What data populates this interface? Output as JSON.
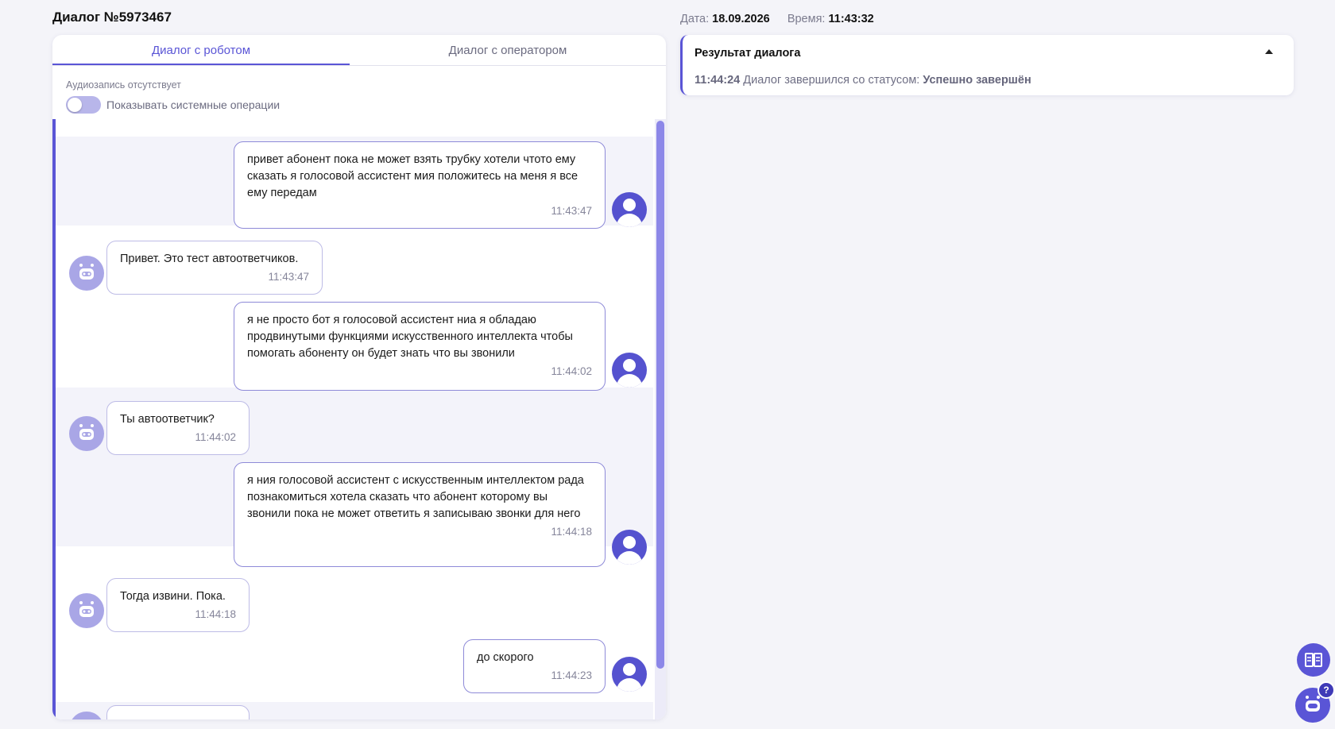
{
  "dialog": {
    "title": "Диалог №5973467"
  },
  "tabs": [
    {
      "label": "Диалог с роботом",
      "active": true
    },
    {
      "label": "Диалог с оператором",
      "active": false
    }
  ],
  "options": {
    "audio_note": "Аудиозапись отсутствует",
    "system_ops_label": "Показывать системные операции",
    "system_ops_on": false
  },
  "messages": [
    {
      "role": "user",
      "text": "привет абонент пока не может взять трубку хотели чтото ему сказать я голосовой ассистент мия положитесь на меня я все ему передам",
      "time": "11:43:47"
    },
    {
      "role": "bot",
      "text": "Привет. Это тест автоответчиков.",
      "time": "11:43:47"
    },
    {
      "role": "user",
      "text": "я не просто бот я голосовой ассистент ниа я обладаю продвинутыми функциями искусственного интеллекта чтобы помогать абоненту он будет знать что вы звонили",
      "time": "11:44:02"
    },
    {
      "role": "bot",
      "text": "Ты автоответчик?",
      "time": "11:44:02"
    },
    {
      "role": "user",
      "text": "я ния голосовой ассистент с искусственным интеллектом рада познакомиться хотела сказать что абонент которому вы звонили пока не может ответить я записываю звонки для него",
      "time": "11:44:18"
    },
    {
      "role": "bot",
      "text": "Тогда извини. Пока.",
      "time": "11:44:18"
    },
    {
      "role": "user",
      "text": "до скорого",
      "time": "11:44:23"
    }
  ],
  "meta": {
    "date_label": "Дата:",
    "date_value": "18.09.2026",
    "time_label": "Время:",
    "time_value": "11:43:32"
  },
  "result": {
    "title": "Результат диалога",
    "time": "11:44:24",
    "text": "Диалог завершился со статусом:",
    "status": "Успешно завершён"
  },
  "icons": {
    "user_avatar": "user-icon",
    "bot_avatar": "robot-icon",
    "collapse": "chevron-up-icon",
    "book": "book-icon",
    "assistant": "robot-icon",
    "help": "?"
  },
  "colors": {
    "accent": "#5a55d6",
    "bot_avatar": "#a9a6e6",
    "band": "#f3f3fa"
  }
}
